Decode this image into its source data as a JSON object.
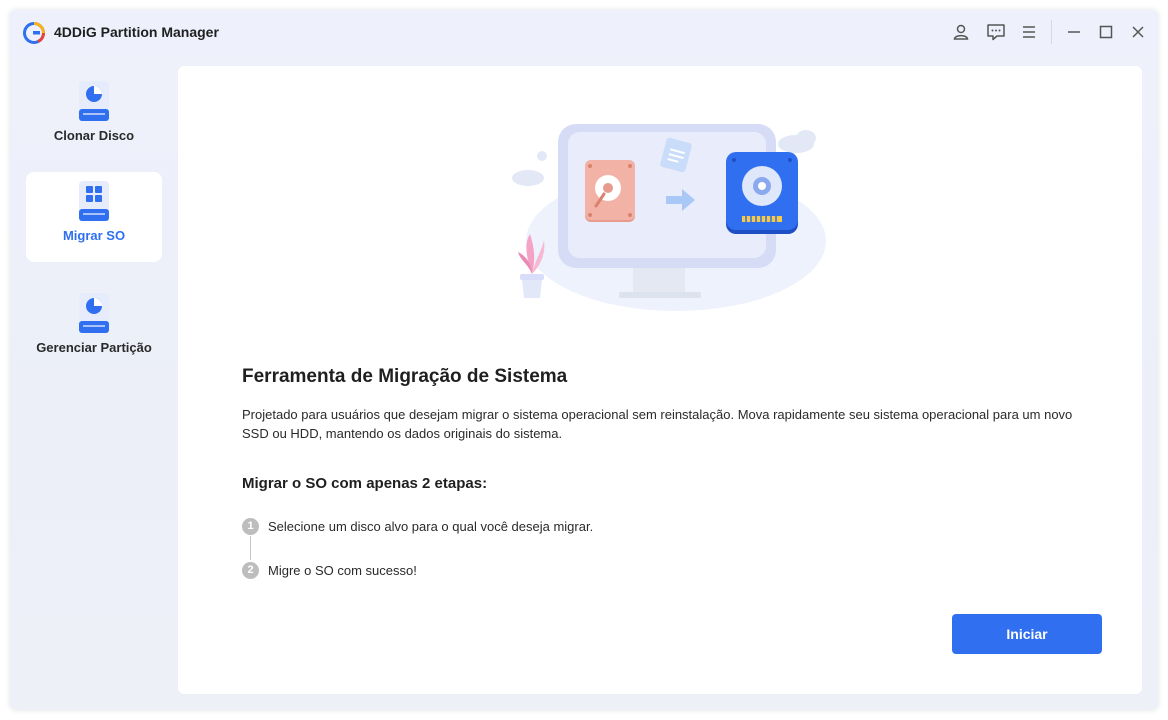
{
  "app": {
    "title": "4DDiG Partition Manager"
  },
  "titlebar": {
    "icons": [
      "user-icon",
      "feedback-icon",
      "menu-icon",
      "minimize-icon",
      "maximize-icon",
      "close-icon"
    ]
  },
  "sidebar": {
    "items": [
      {
        "label": "Clonar Disco",
        "icon": "disk-pie-icon",
        "active": false
      },
      {
        "label": "Migrar SO",
        "icon": "disk-windows-icon",
        "active": true
      },
      {
        "label": "Gerenciar Partição",
        "icon": "disk-pie-icon",
        "active": false
      }
    ]
  },
  "main": {
    "title": "Ferramenta de Migração de Sistema",
    "description": "Projetado para usuários que desejam migrar o sistema operacional sem reinstalação. Mova rapidamente seu sistema operacional para um novo SSD ou HDD, mantendo os dados originais do sistema.",
    "steps_title": "Migrar o SO com apenas 2 etapas:",
    "steps": [
      {
        "number": "1",
        "text": "Selecione um disco alvo para o qual você deseja migrar."
      },
      {
        "number": "2",
        "text": "Migre o SO com sucesso!"
      }
    ],
    "start_label": "Iniciar"
  },
  "colors": {
    "accent": "#2f6ff0",
    "background": "#eef1fb",
    "panel": "#ffffff",
    "step_badge": "#bdbdbd"
  }
}
